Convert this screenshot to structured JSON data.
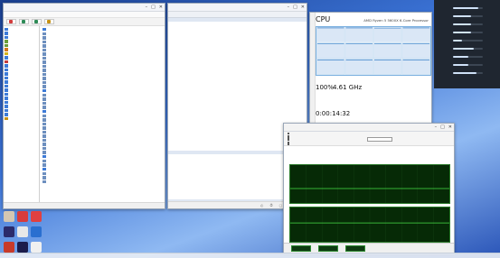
{
  "colors": {
    "wallpaper": "#3b73d6",
    "cpu_graph_line": "#1f6fc2",
    "occt_line": "#48e048",
    "occt_bg": "#062a06",
    "panel_bg": "#1f2630"
  },
  "aida_window": {
    "title": "",
    "menu": [],
    "toolbar": [
      {
        "label": "",
        "icon": "report-icon",
        "color": "#d23c3c"
      },
      {
        "label": "",
        "icon": "bios-icon",
        "color": "#2e8b57"
      },
      {
        "label": "",
        "icon": "driver-icon",
        "color": "#2e8b57"
      },
      {
        "label": "",
        "icon": "benchmark-icon",
        "color": "#c69214"
      }
    ],
    "tree": [
      {
        "label": "",
        "icon": "computer-icon",
        "color": "#3d7bd8"
      },
      {
        "label": "",
        "icon": "summary-icon",
        "color": "#3d7bd8"
      },
      {
        "label": "",
        "icon": "name-icon",
        "color": "#3d7bd8"
      },
      {
        "label": "",
        "icon": "dmi-icon",
        "color": "#6a9d3a"
      },
      {
        "label": "",
        "icon": "ipmi-icon",
        "color": "#6a9d3a"
      },
      {
        "label": "",
        "icon": "overclock-icon",
        "color": "#d27a1a"
      },
      {
        "label": "",
        "icon": "power-icon",
        "color": "#d2b41a"
      },
      {
        "label": "",
        "icon": "portable-icon",
        "color": "#3d7bd8"
      },
      {
        "label": "",
        "icon": "sensor-icon",
        "color": "#c23c3c"
      },
      {
        "label": "",
        "icon": "motherboard-icon",
        "color": "#3d7bd8"
      },
      {
        "label": "",
        "icon": "os-icon",
        "color": "#3d7bd8"
      },
      {
        "label": "",
        "icon": "server-icon",
        "color": "#3d7bd8"
      },
      {
        "label": "",
        "icon": "display-icon",
        "color": "#3d7bd8"
      },
      {
        "label": "",
        "icon": "multimedia-icon",
        "color": "#3d7bd8"
      },
      {
        "label": "",
        "icon": "storage-icon",
        "color": "#3d7bd8"
      },
      {
        "label": "",
        "icon": "network-icon",
        "color": "#3d7bd8"
      },
      {
        "label": "",
        "icon": "directx-icon",
        "color": "#3d7bd8"
      },
      {
        "label": "",
        "icon": "devices-icon",
        "color": "#3d7bd8"
      },
      {
        "label": "",
        "icon": "software-icon",
        "color": "#3d7bd8"
      },
      {
        "label": "",
        "icon": "security-icon",
        "color": "#3d7bd8"
      },
      {
        "label": "",
        "icon": "config-icon",
        "color": "#3d7bd8"
      },
      {
        "label": "",
        "icon": "database-icon",
        "color": "#3d7bd8"
      },
      {
        "label": "",
        "icon": "benchmark-icon",
        "color": "#c69214"
      }
    ],
    "sections": [
      {
        "title": "",
        "rows": [
          {
            "label": "",
            "value": ""
          },
          {
            "label": "",
            "value": ""
          },
          {
            "label": "",
            "value": ""
          },
          {
            "label": "",
            "value": ""
          },
          {
            "label": "",
            "value": ""
          },
          {
            "label": "",
            "value": ""
          },
          {
            "label": "",
            "value": ""
          },
          {
            "label": "",
            "value": ""
          },
          {
            "label": "",
            "value": ""
          },
          {
            "label": "",
            "value": ""
          },
          {
            "label": "",
            "value": ""
          },
          {
            "label": "",
            "value": ""
          },
          {
            "label": "",
            "value": ""
          },
          {
            "label": "",
            "value": ""
          }
        ]
      },
      {
        "title": "",
        "rows": [
          {
            "label": "",
            "value": ""
          },
          {
            "label": "",
            "value": ""
          },
          {
            "label": "",
            "value": ""
          },
          {
            "label": "",
            "value": ""
          }
        ]
      },
      {
        "title": "",
        "rows": [
          {
            "label": "",
            "value": ""
          },
          {
            "label": "",
            "value": ""
          },
          {
            "label": "",
            "value": ""
          },
          {
            "label": "",
            "value": ""
          },
          {
            "label": "",
            "value": ""
          },
          {
            "label": "",
            "value": ""
          },
          {
            "label": "",
            "value": ""
          },
          {
            "label": "",
            "value": ""
          },
          {
            "label": "",
            "value": ""
          },
          {
            "label": "",
            "value": ""
          }
        ]
      },
      {
        "title": "",
        "rows": [
          {
            "label": "",
            "value": ""
          },
          {
            "label": "",
            "value": ""
          }
        ]
      },
      {
        "title": "",
        "rows": [
          {
            "label": "",
            "value": ""
          },
          {
            "label": "",
            "value": ""
          },
          {
            "label": "",
            "value": ""
          }
        ]
      }
    ],
    "status": ""
  },
  "sensor_window": {
    "title": "",
    "columns": [
      "",
      "",
      "",
      "",
      ""
    ],
    "groups": [
      {
        "name": "",
        "rows": [
          [
            "",
            "",
            "",
            "",
            ""
          ],
          [
            "",
            "",
            "",
            "",
            ""
          ],
          [
            "",
            "",
            "",
            "",
            ""
          ],
          [
            "",
            "",
            "",
            "",
            ""
          ],
          [
            "",
            "",
            "",
            "",
            ""
          ],
          [
            "",
            "",
            "",
            "",
            ""
          ],
          [
            "",
            "",
            "",
            "",
            ""
          ],
          [
            "",
            "",
            "",
            "",
            ""
          ],
          [
            "",
            "",
            "",
            "",
            ""
          ],
          [
            "",
            "",
            "",
            "",
            ""
          ],
          [
            "",
            "",
            "",
            "",
            ""
          ],
          [
            "",
            "",
            "",
            "",
            ""
          ],
          [
            "",
            "",
            "",
            "",
            ""
          ],
          [
            "",
            "",
            "",
            "",
            ""
          ],
          [
            "",
            "",
            "",
            "",
            ""
          ],
          [
            "",
            "",
            "",
            "",
            ""
          ],
          [
            "",
            "",
            "",
            "",
            ""
          ],
          [
            "",
            "",
            "",
            "",
            ""
          ],
          [
            "",
            "",
            "",
            "",
            ""
          ],
          [
            "",
            "",
            "",
            "",
            ""
          ],
          [
            "",
            "",
            "",
            "",
            ""
          ],
          [
            "",
            "",
            "",
            "",
            ""
          ],
          [
            "",
            "",
            "",
            "",
            ""
          ],
          [
            "",
            "",
            "",
            "",
            ""
          ],
          [
            "",
            "",
            "",
            "",
            ""
          ],
          [
            "",
            "",
            "",
            "",
            ""
          ],
          [
            "",
            "",
            "",
            "",
            ""
          ],
          [
            "",
            "",
            "",
            "",
            ""
          ],
          [
            "",
            "",
            "",
            "",
            ""
          ],
          [
            "",
            "",
            "",
            "",
            ""
          ],
          [
            "",
            "",
            "",
            "",
            ""
          ],
          [
            "",
            "",
            "",
            "",
            ""
          ],
          [
            "",
            "",
            "",
            "",
            ""
          ],
          [
            "",
            "",
            "",
            "",
            ""
          ],
          [
            "",
            "",
            "",
            "",
            ""
          ],
          [
            "",
            "",
            "",
            "",
            ""
          ],
          [
            "",
            "",
            "",
            "",
            ""
          ],
          [
            "",
            "",
            "",
            "",
            ""
          ],
          [
            "",
            "",
            "",
            "",
            ""
          ],
          [
            "",
            "",
            "",
            "",
            ""
          ]
        ]
      },
      {
        "name": "",
        "rows": [
          [
            "",
            "",
            "",
            "",
            ""
          ],
          [
            "",
            "",
            "",
            "",
            ""
          ],
          [
            "",
            "",
            "",
            "",
            ""
          ],
          [
            "",
            "",
            "",
            "",
            ""
          ],
          [
            "",
            "",
            "",
            "",
            ""
          ],
          [
            "",
            "",
            "",
            "",
            ""
          ],
          [
            "",
            "",
            "",
            "",
            ""
          ],
          [
            "",
            "",
            "",
            "",
            ""
          ],
          [
            "",
            "",
            "",
            "",
            ""
          ],
          [
            "",
            "",
            "",
            "",
            ""
          ],
          [
            "",
            "",
            "",
            "",
            ""
          ],
          [
            "",
            "",
            "",
            "",
            ""
          ],
          [
            "",
            "",
            "",
            "",
            ""
          ],
          [
            "",
            "",
            "",
            "",
            ""
          ]
        ]
      },
      {
        "name": "",
        "rows": [
          [
            "",
            "",
            "",
            "",
            ""
          ],
          [
            "",
            "",
            "",
            "",
            ""
          ],
          [
            "",
            "",
            "",
            "",
            ""
          ],
          [
            "",
            "",
            "",
            "",
            ""
          ],
          [
            "",
            "",
            "",
            "",
            ""
          ],
          [
            "",
            "",
            "",
            "",
            ""
          ],
          [
            "",
            "",
            "",
            "",
            ""
          ],
          [
            "",
            "",
            "",
            "",
            ""
          ]
        ]
      }
    ]
  },
  "taskmgr_window": {
    "title": "",
    "heading": "CPU",
    "processor": "AMD Ryzen 5 5600X 6-Core Processor",
    "utilization_label": "",
    "utilization": "100%",
    "speed_label": "",
    "speed": "4.61 GHz",
    "processes_label": "",
    "processes": "",
    "threads_label": "",
    "threads": "",
    "handles_label": "",
    "handles": "",
    "uptime_label": "",
    "uptime": "0:00:14:32",
    "details": [
      {
        "label": "",
        "value": ""
      },
      {
        "label": "",
        "value": ""
      },
      {
        "label": "",
        "value": ""
      },
      {
        "label": "",
        "value": ""
      },
      {
        "label": "",
        "value": ""
      },
      {
        "label": "",
        "value": ""
      }
    ],
    "cores_graph": [
      100,
      100,
      99,
      100,
      100,
      100,
      100,
      100,
      100,
      100,
      100,
      100
    ]
  },
  "occt_window": {
    "title": "",
    "checks": [
      {
        "label": ""
      },
      {
        "label": ""
      },
      {
        "label": ""
      },
      {
        "label": ""
      },
      {
        "label": ""
      },
      {
        "label": ""
      }
    ],
    "tabs": [],
    "chart1": {
      "series": [
        {
          "values": [
            38,
            38,
            38,
            38,
            38,
            38,
            38,
            38,
            38,
            38,
            38,
            38,
            38,
            38,
            38,
            38,
            38,
            38,
            38,
            38,
            38,
            38,
            38,
            38,
            38,
            38,
            38,
            38,
            38,
            38,
            38,
            38,
            38,
            38,
            38,
            38,
            38,
            38,
            38,
            38,
            38,
            38,
            38,
            38,
            38,
            38,
            38,
            38,
            38,
            38
          ]
        }
      ],
      "ylim": [
        0,
        100
      ]
    },
    "chart2": {
      "series": [
        {
          "values": [
            55,
            55,
            55,
            55,
            55,
            55,
            55,
            55,
            55,
            55,
            55,
            55,
            55,
            55,
            55,
            55,
            55,
            55,
            55,
            55,
            55,
            55,
            55,
            55,
            55,
            55,
            55,
            55,
            55,
            55,
            55,
            55,
            55,
            55,
            55,
            55,
            55,
            55,
            55,
            55,
            55,
            55,
            55,
            55,
            55,
            55,
            55,
            55,
            55,
            55
          ]
        }
      ],
      "ylim": [
        0,
        100
      ]
    },
    "footer": [
      {
        "label": "",
        "value": ""
      },
      {
        "label": "",
        "value": ""
      },
      {
        "label": "",
        "value": ""
      }
    ]
  },
  "right_panel": {
    "rows": [
      {
        "label": "",
        "value": "",
        "level": 0.85
      },
      {
        "label": "",
        "value": "",
        "level": 0.6
      },
      {
        "label": "",
        "value": "",
        "level": 0.6
      },
      {
        "label": "",
        "value": "",
        "level": 0.6
      },
      {
        "label": "",
        "value": "",
        "level": 0.3
      },
      {
        "label": "",
        "value": "",
        "level": 0.7
      },
      {
        "label": "",
        "value": "",
        "level": 0.5
      },
      {
        "label": "",
        "value": "",
        "level": 0.5
      },
      {
        "label": "",
        "value": "",
        "level": 0.8
      }
    ]
  },
  "desktop_icons": [
    {
      "label": "",
      "color": "#d4c7b2"
    },
    {
      "label": "",
      "color": "#2b2b6b"
    },
    {
      "label": "",
      "color": "#c83a2a"
    },
    {
      "label": "",
      "color": "#d83b3b"
    },
    {
      "label": "",
      "color": "#e8e8e8"
    },
    {
      "label": "",
      "color": "#1b1b4b"
    },
    {
      "label": "",
      "color": "#e04040"
    },
    {
      "label": "",
      "color": "#2a6fd0"
    },
    {
      "label": "",
      "color": "#f0f0f0"
    }
  ]
}
